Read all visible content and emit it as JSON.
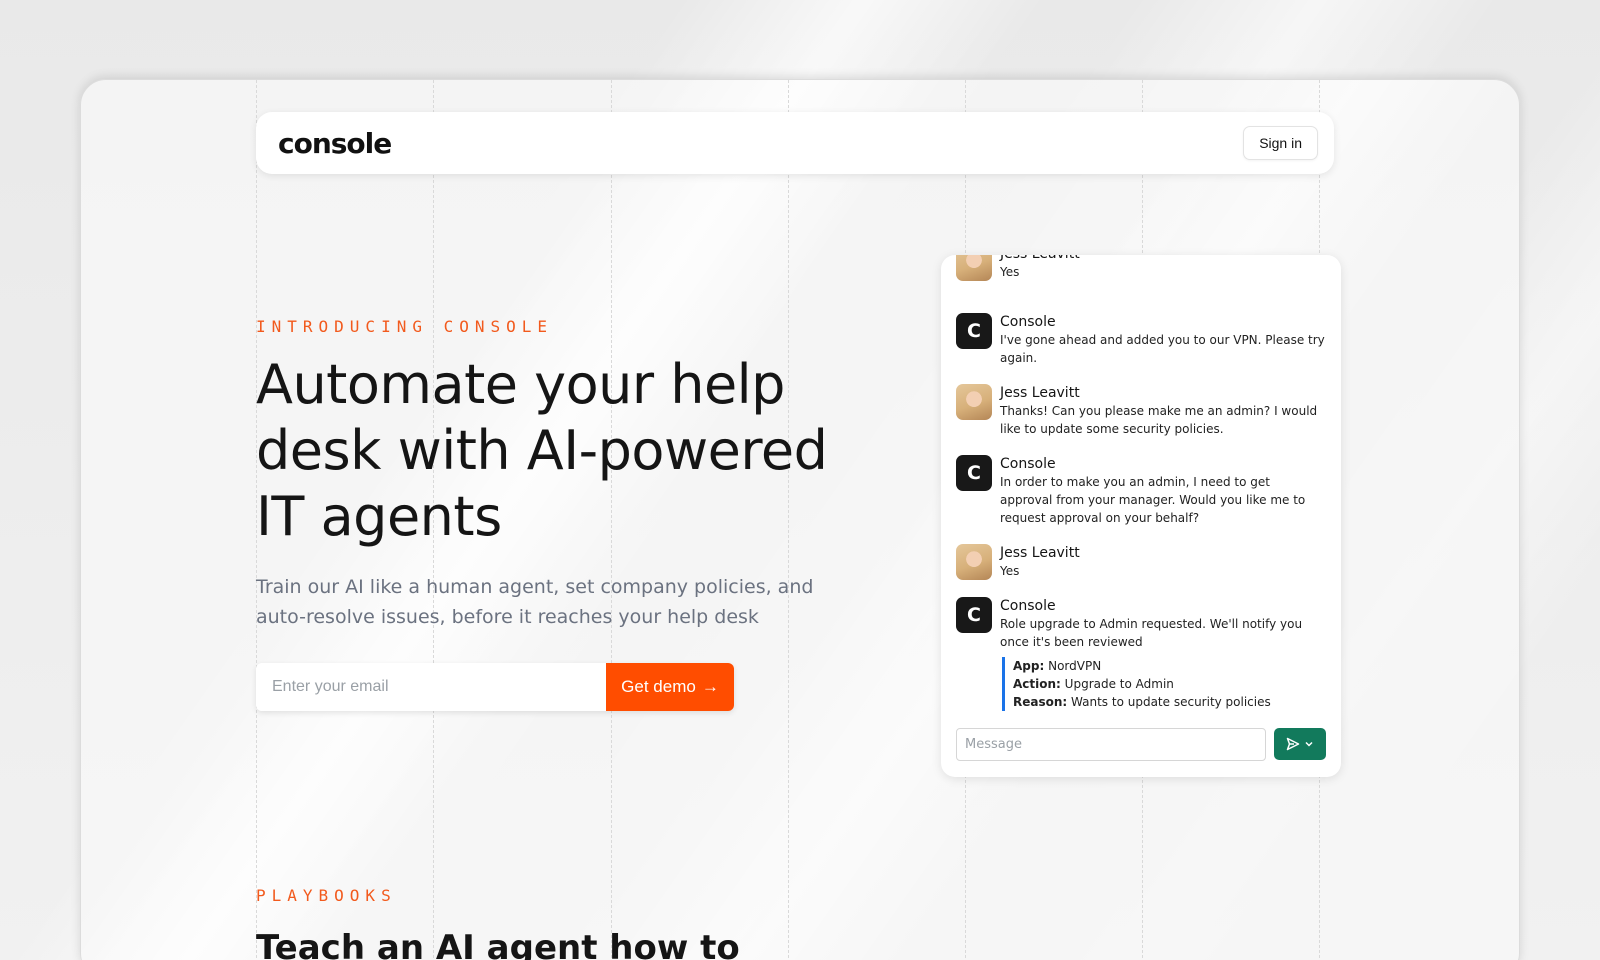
{
  "nav": {
    "logo": "console",
    "signin_label": "Sign in"
  },
  "hero": {
    "eyebrow": "INTRODUCING CONSOLE",
    "title": "Automate your help desk with AI-powered IT agents",
    "subtitle": "Train our AI like a human agent, set company policies, and auto-resolve issues, before it reaches your help desk",
    "email_placeholder": "Enter your email",
    "demo_label": "Get demo",
    "demo_arrow": "→"
  },
  "chat": {
    "messages": [
      {
        "sender": "Jess Leavitt",
        "text": "Yes"
      },
      {
        "sender": "Console",
        "text": "I've gone ahead and added you to our VPN. Please try again."
      },
      {
        "sender": "Jess Leavitt",
        "text": "Thanks! Can you please make me an admin?  I would like to update some security policies."
      },
      {
        "sender": "Console",
        "text": "In order to make you an admin, I need to get approval from your manager. Would you like me to request approval on your behalf?"
      },
      {
        "sender": "Jess Leavitt",
        "text": "Yes"
      },
      {
        "sender": "Console",
        "text": "Role upgrade to Admin requested. We'll notify you once it's been reviewed"
      }
    ],
    "bot_avatar_letter": "C",
    "details": [
      {
        "label": "App:",
        "value": "NordVPN"
      },
      {
        "label": "Action:",
        "value": "Upgrade to Admin"
      },
      {
        "label": "Reason:",
        "value": "Wants to update security policies"
      }
    ],
    "input_placeholder": "Message",
    "accent": "#127a5c"
  },
  "section2": {
    "eyebrow": "PLAYBOOKS",
    "title": "Teach an AI agent how to"
  },
  "colors": {
    "brand_orange": "#ff4d00",
    "eyebrow_orange": "#f25a1d",
    "detail_bar": "#1a73e8"
  }
}
